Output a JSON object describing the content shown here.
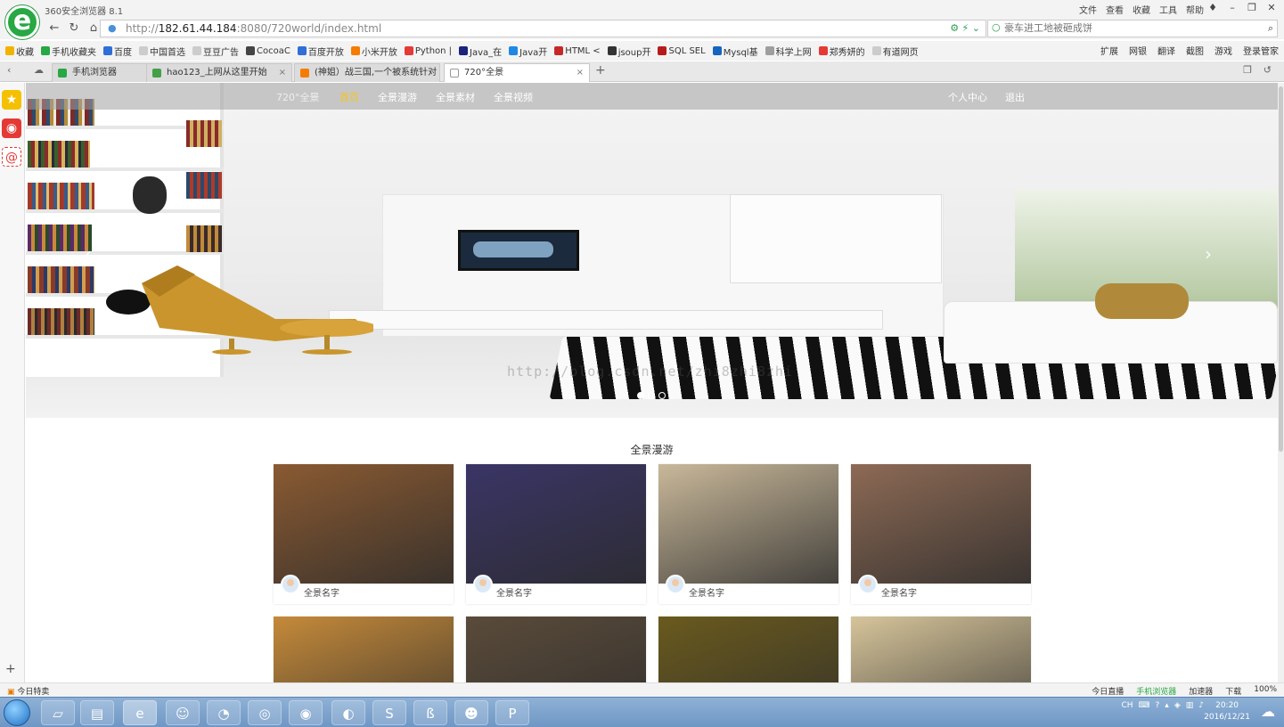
{
  "browser": {
    "title": "360安全浏览器 8.1",
    "menu": [
      "文件",
      "查看",
      "收藏",
      "工具",
      "帮助"
    ],
    "url_host": "182.61.44.184",
    "url_prefix": "http://",
    "url_suffix": ":8080/720world/index.html",
    "search_placeholder": "豪车进工地被砸成饼"
  },
  "bookmarks": {
    "items": [
      {
        "label": "收藏",
        "color": "#f0b400"
      },
      {
        "label": "手机收藏夹",
        "color": "#27a843"
      },
      {
        "label": "百度",
        "color": "#2f6fd6"
      },
      {
        "label": "中国首选",
        "color": "#cccccc"
      },
      {
        "label": "豆豆广告",
        "color": "#cccccc"
      },
      {
        "label": "CocoaC",
        "color": "#444444"
      },
      {
        "label": "百度开放",
        "color": "#2f6fd6"
      },
      {
        "label": "小米开放",
        "color": "#f57c00"
      },
      {
        "label": "Python |",
        "color": "#e53935"
      },
      {
        "label": "Java_在",
        "color": "#1a237e"
      },
      {
        "label": "Java开",
        "color": "#1e88e5"
      },
      {
        "label": "HTML <",
        "color": "#c62828"
      },
      {
        "label": "jsoup开",
        "color": "#333333"
      },
      {
        "label": "SQL SEL",
        "color": "#b71c1c"
      },
      {
        "label": "Mysql基",
        "color": "#1565c0"
      },
      {
        "label": "科学上网",
        "color": "#9e9e9e"
      },
      {
        "label": "郑秀妍的",
        "color": "#e53935"
      },
      {
        "label": "有道网页",
        "color": "#cccccc"
      }
    ],
    "right": [
      "扩展",
      "网银",
      "翻译",
      "截图",
      "游戏",
      "登录管家"
    ]
  },
  "tabs": [
    {
      "label": "手机浏览器",
      "color": "#27a843"
    },
    {
      "label": "hao123_上网从这里开始",
      "color": "#43a047"
    },
    {
      "label": "(神姐）战三国,一个被系统针对",
      "color": "#f57c00"
    },
    {
      "label": "720°全景",
      "color": "#999999"
    }
  ],
  "site": {
    "brand": "720°全景",
    "nav": [
      "首页",
      "全景漫游",
      "全景素材",
      "全景视频"
    ],
    "user_nav": [
      "个人中心",
      "退出"
    ],
    "watermark": "http://blog.csdn.net/zhi8zhi8zhi",
    "section_title": "全景漫游",
    "cards": [
      {
        "name": "全景名字",
        "tint": "#8a5a32"
      },
      {
        "name": "全景名字",
        "tint": "#3a3566"
      },
      {
        "name": "全景名字",
        "tint": "#c9b89a"
      },
      {
        "name": "全景名字",
        "tint": "#8d6a55"
      },
      {
        "name": "",
        "tint": "#c58a3a"
      },
      {
        "name": "",
        "tint": "#5a4b3a"
      },
      {
        "name": "",
        "tint": "#6a5a1e"
      },
      {
        "name": "",
        "tint": "#d6c49a"
      }
    ]
  },
  "status": {
    "left": "今日特卖",
    "right": [
      "今日直播",
      "手机浏览器",
      "加速器",
      "下载",
      "100%"
    ]
  },
  "taskbar": {
    "clock_time": "20:20",
    "clock_date": "2016/12/21",
    "ime": "CH"
  }
}
